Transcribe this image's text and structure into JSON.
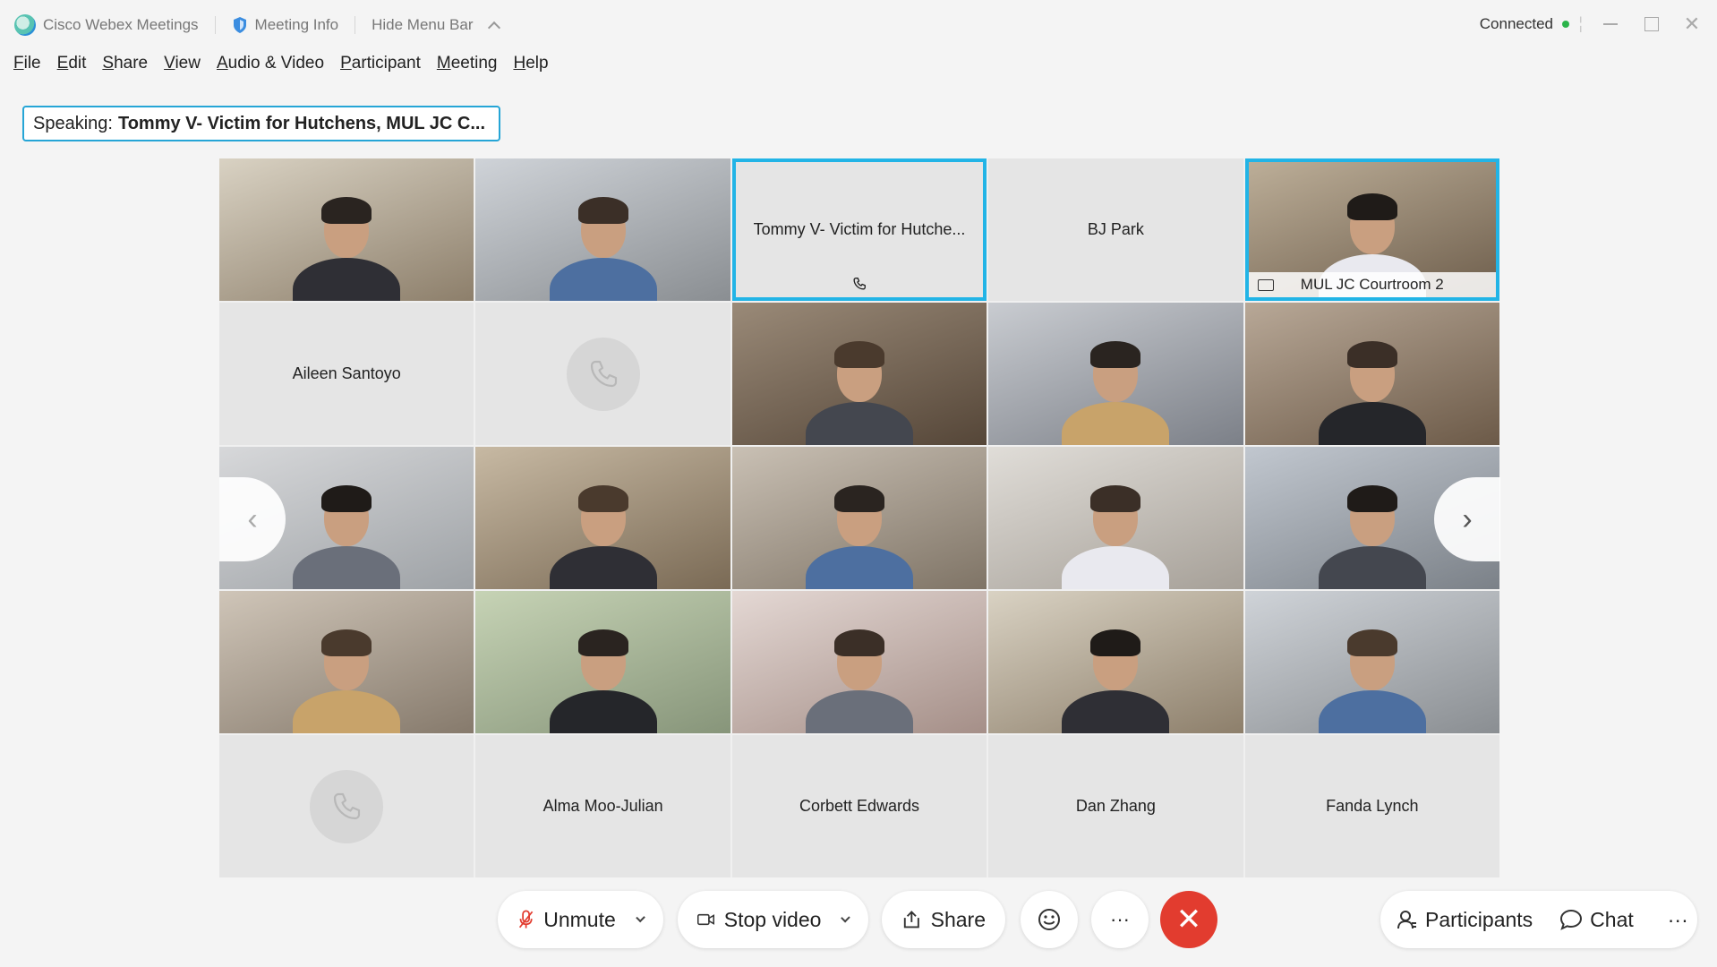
{
  "titlebar": {
    "app_name": "Cisco Webex Meetings",
    "meeting_info": "Meeting Info",
    "hide_menu_bar": "Hide Menu Bar",
    "status": "Connected",
    "close_glyph": "✕"
  },
  "menu": [
    "File",
    "Edit",
    "Share",
    "View",
    "Audio & Video",
    "Participant",
    "Meeting",
    "Help"
  ],
  "speaking": {
    "prefix": "Speaking:",
    "name": "Tommy V- Victim for Hutchens, MUL JC C..."
  },
  "tiles": [
    {
      "type": "video",
      "label": ""
    },
    {
      "type": "video",
      "label": ""
    },
    {
      "type": "name",
      "label": "Tommy V- Victim for Hutche...",
      "active_speaker": true,
      "icon": "phone-icon"
    },
    {
      "type": "name",
      "label": "BJ Park"
    },
    {
      "type": "video",
      "label": "MUL JC Courtroom 2",
      "active_speaker": true,
      "icon": "monitor-icon"
    },
    {
      "type": "name",
      "label": "Aileen Santoyo"
    },
    {
      "type": "phone",
      "label": ""
    },
    {
      "type": "video",
      "label": ""
    },
    {
      "type": "video",
      "label": ""
    },
    {
      "type": "video",
      "label": ""
    },
    {
      "type": "video",
      "label": ""
    },
    {
      "type": "video",
      "label": ""
    },
    {
      "type": "video",
      "label": ""
    },
    {
      "type": "video",
      "label": ""
    },
    {
      "type": "video",
      "label": ""
    },
    {
      "type": "video",
      "label": ""
    },
    {
      "type": "video",
      "label": ""
    },
    {
      "type": "video",
      "label": ""
    },
    {
      "type": "video",
      "label": ""
    },
    {
      "type": "video",
      "label": ""
    },
    {
      "type": "phone",
      "label": ""
    },
    {
      "type": "name",
      "label": "Alma Moo-Julian"
    },
    {
      "type": "name",
      "label": "Corbett Edwards"
    },
    {
      "type": "name",
      "label": "Dan Zhang"
    },
    {
      "type": "name",
      "label": "Fanda Lynch"
    }
  ],
  "navigation": {
    "prev_glyph": "‹",
    "next_glyph": "›"
  },
  "toolbar": {
    "unmute": "Unmute",
    "stop_video": "Stop video",
    "share": "Share",
    "more": "···",
    "end_glyph": "✕",
    "participants": "Participants",
    "chat": "Chat",
    "more_right": "···"
  },
  "colors": {
    "accent": "#22b4e6",
    "end_call": "#e23c2f",
    "connected": "#2bb44a"
  }
}
